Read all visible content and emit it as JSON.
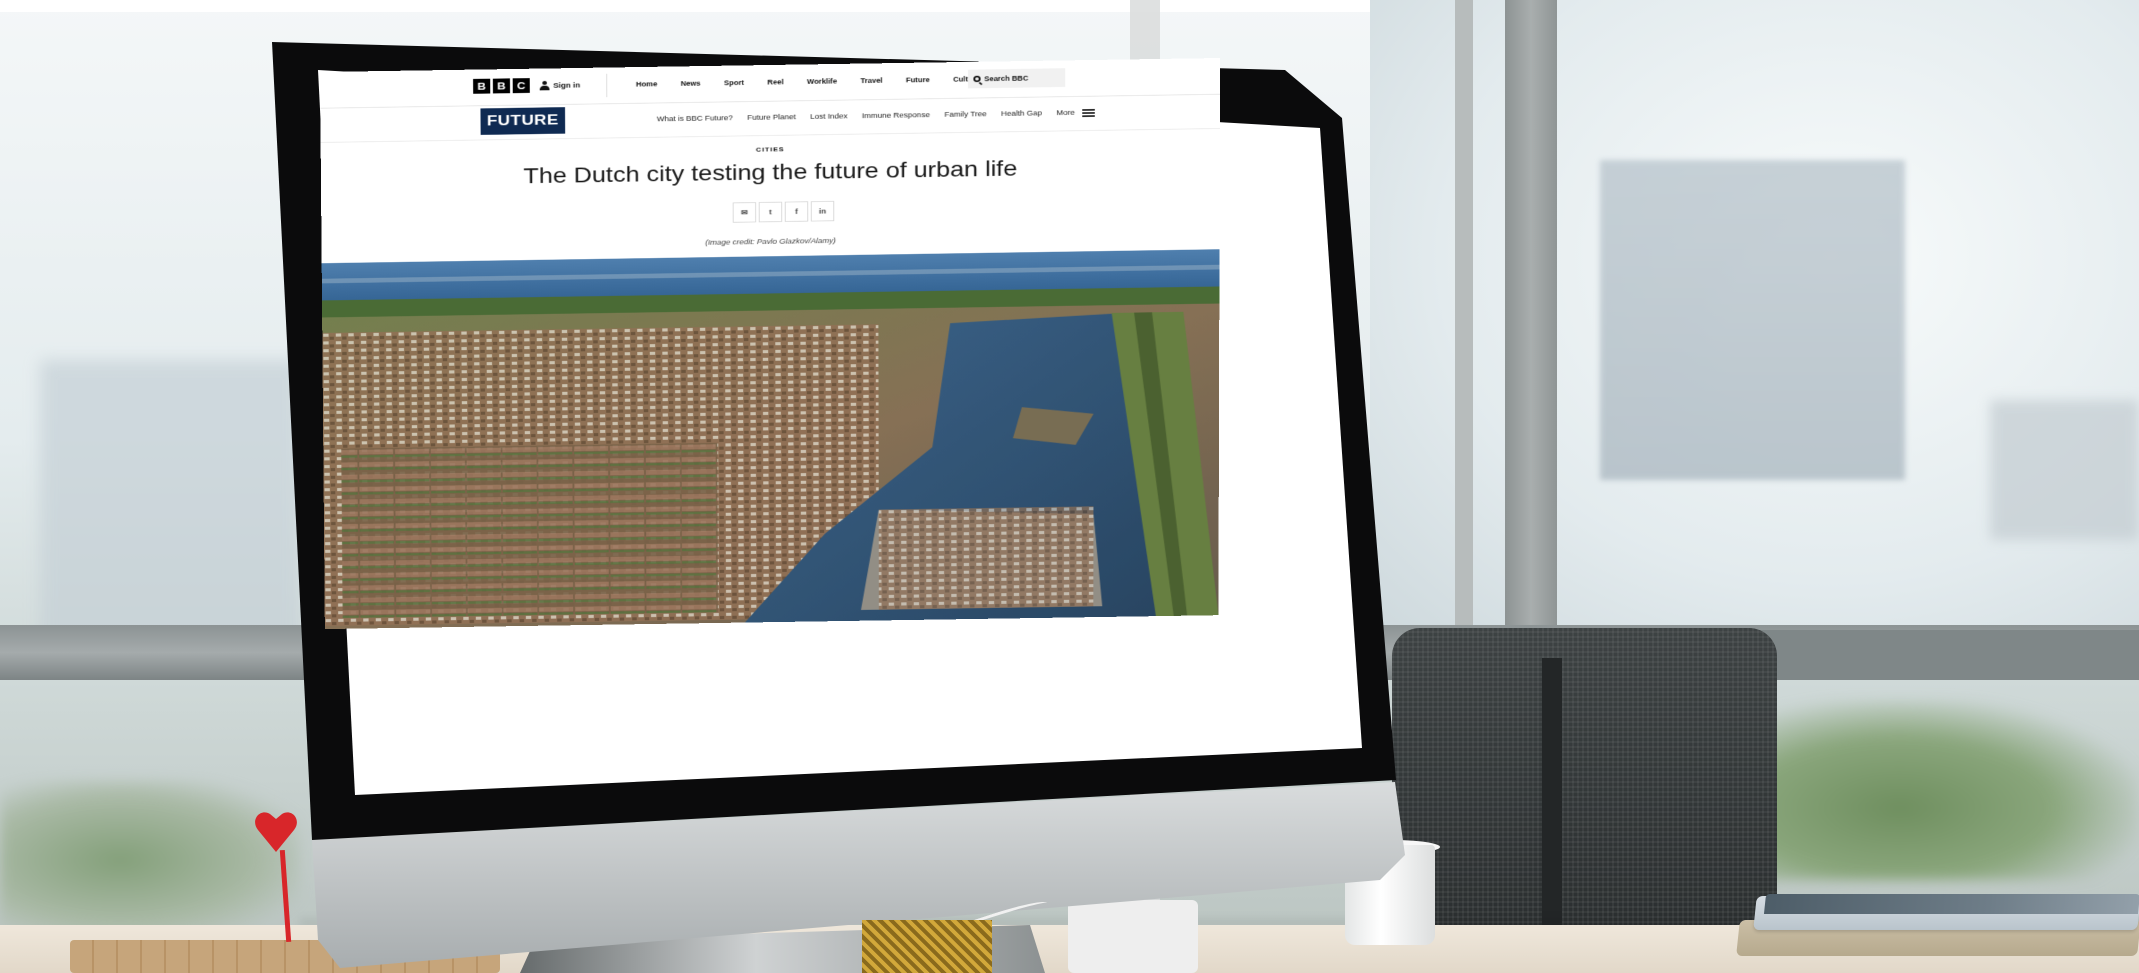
{
  "scene": "desk-monitor",
  "page": {
    "logo_letters": [
      "B",
      "B",
      "C"
    ],
    "sign_in": "Sign in",
    "main_nav": [
      "Home",
      "News",
      "Sport",
      "Reel",
      "Worklife",
      "Travel",
      "Future",
      "Culture"
    ],
    "more_dots": "•••",
    "search_placeholder": "Search BBC",
    "section_logo": "FUTURE",
    "sub_nav": [
      "What is BBC Future?",
      "Future Planet",
      "Lost Index",
      "Immune Response",
      "Family Tree",
      "Health Gap"
    ],
    "sub_nav_more": "More",
    "section_label": "CITIES",
    "headline": "The Dutch city testing the future of urban life",
    "share_icons": [
      "email-icon",
      "twitter-icon",
      "facebook-icon",
      "linkedin-icon"
    ],
    "share_glyphs": [
      "✉",
      "t",
      "f",
      "in"
    ],
    "image_credit": "(Image credit: Pavlo Glazkov/Alamy)"
  },
  "colors": {
    "future_logo_bg": "#0f2a52",
    "water": "#1f4a72",
    "sea": "#3c6c9c",
    "pin": "#d8262a"
  }
}
